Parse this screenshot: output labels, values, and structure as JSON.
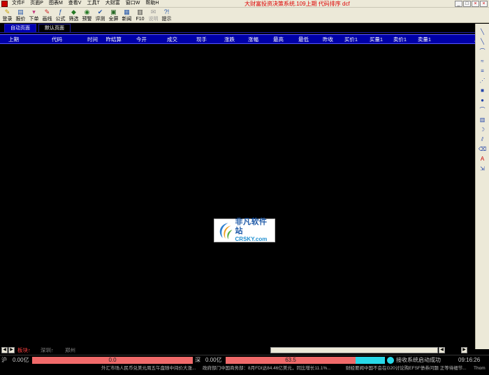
{
  "menubar": {
    "items": [
      "文件F",
      "页面P",
      "图表M",
      "查看V",
      "工具T",
      "大财富",
      "窗口W",
      "帮助H"
    ],
    "title": "大财富投资决策系统.109上期 代码排序 dcf",
    "window_buttons": [
      "_",
      "□",
      "×",
      "×"
    ]
  },
  "toolbar": {
    "items": [
      {
        "label": "登录",
        "icon": "key-icon",
        "glyph": "✎",
        "color": "#c8a000"
      },
      {
        "label": "报价",
        "icon": "quote-icon",
        "glyph": "▤",
        "color": "#2255aa"
      },
      {
        "label": "下单",
        "icon": "order-icon",
        "glyph": "▾",
        "color": "#c0307a"
      },
      {
        "label": "画线",
        "icon": "draw-line-icon",
        "glyph": "✎",
        "color": "#cc2222"
      },
      {
        "label": "公式",
        "icon": "formula-icon",
        "glyph": "ƒ",
        "color": "#2255aa"
      },
      {
        "label": "筛选",
        "icon": "filter-icon",
        "glyph": "◆",
        "color": "#227722"
      },
      {
        "label": "预警",
        "icon": "alert-icon",
        "glyph": "◉",
        "color": "#227722"
      },
      {
        "label": "评测",
        "icon": "evaluate-icon",
        "glyph": "✔",
        "color": "#2255aa"
      },
      {
        "label": "全屏",
        "icon": "fullscreen-icon",
        "glyph": "▣",
        "color": "#226622"
      },
      {
        "label": "新闻",
        "icon": "news-icon",
        "glyph": "▦",
        "color": "#2255aa"
      },
      {
        "label": "F10",
        "icon": "f10-icon",
        "glyph": "▥",
        "color": "#333333"
      },
      {
        "label": "说明",
        "icon": "manual-icon",
        "glyph": "✉",
        "color": "#999999",
        "disabled": true
      },
      {
        "label": "提示",
        "icon": "hint-icon",
        "glyph": "?!",
        "color": "#2255aa"
      }
    ]
  },
  "page_tabs": [
    "自动页面",
    "默认页面"
  ],
  "table": {
    "columns": [
      "上期",
      "代码",
      "时间",
      "昨结算",
      "今开",
      "成交",
      "现手",
      "涨跌",
      "涨幅",
      "最高",
      "最低",
      "昨收",
      "买价1",
      "买量1",
      "卖价1",
      "卖量1",
      "总量"
    ]
  },
  "watermark": {
    "main": "非凡软件站",
    "sub": "CRSKY.com"
  },
  "right_tools": [
    {
      "icon": "line-tool-icon",
      "glyph": "╲"
    },
    {
      "icon": "ray-tool-icon",
      "glyph": "╲"
    },
    {
      "icon": "arc-tool-icon",
      "glyph": "⌒"
    },
    {
      "icon": "wave-tool-icon",
      "glyph": "≈"
    },
    {
      "icon": "channel-tool-icon",
      "glyph": "≡"
    },
    {
      "icon": "fan-tool-icon",
      "glyph": "⋰"
    },
    {
      "icon": "rectangle-tool-icon",
      "glyph": "■"
    },
    {
      "icon": "ellipse-tool-icon",
      "glyph": "●"
    },
    {
      "icon": "cycle-tool-icon",
      "glyph": "⌒"
    },
    {
      "icon": "gann-tool-icon",
      "glyph": "▥"
    },
    {
      "icon": "spiral-tool-icon",
      "glyph": "☽"
    },
    {
      "icon": "parallel-tool-icon",
      "glyph": "⫽"
    },
    {
      "icon": "eraser-tool-icon",
      "glyph": "⌫"
    },
    {
      "icon": "text-tool-icon",
      "glyph": "A",
      "red": true
    },
    {
      "icon": "delete-tool-icon",
      "glyph": "⇲"
    }
  ],
  "board_tabs": [
    {
      "label": "板块↑",
      "color": "#ff4040"
    },
    {
      "label": "深圳↑",
      "color": "#888888"
    },
    {
      "label": "郑州",
      "color": "#888888"
    }
  ],
  "status": {
    "sh_label": "沪",
    "sh_amount": "0.00亿",
    "sh_index": "0.0",
    "sz_label": "深",
    "sz_amount": "0.00亿",
    "sz_index": "63.5",
    "message": "接收系统启动成功",
    "time": "09:16:26"
  },
  "ticker": [
    "外汇市场人民币兑美元周五午盘随中间价大涨...",
    "政府部门中国商务部：8月FDI达84.46亿美元，同比增长11.1%...",
    "财经要闻中国不会在G20讨论购EFSF债券问题 正等待细节...",
    "Thom"
  ]
}
